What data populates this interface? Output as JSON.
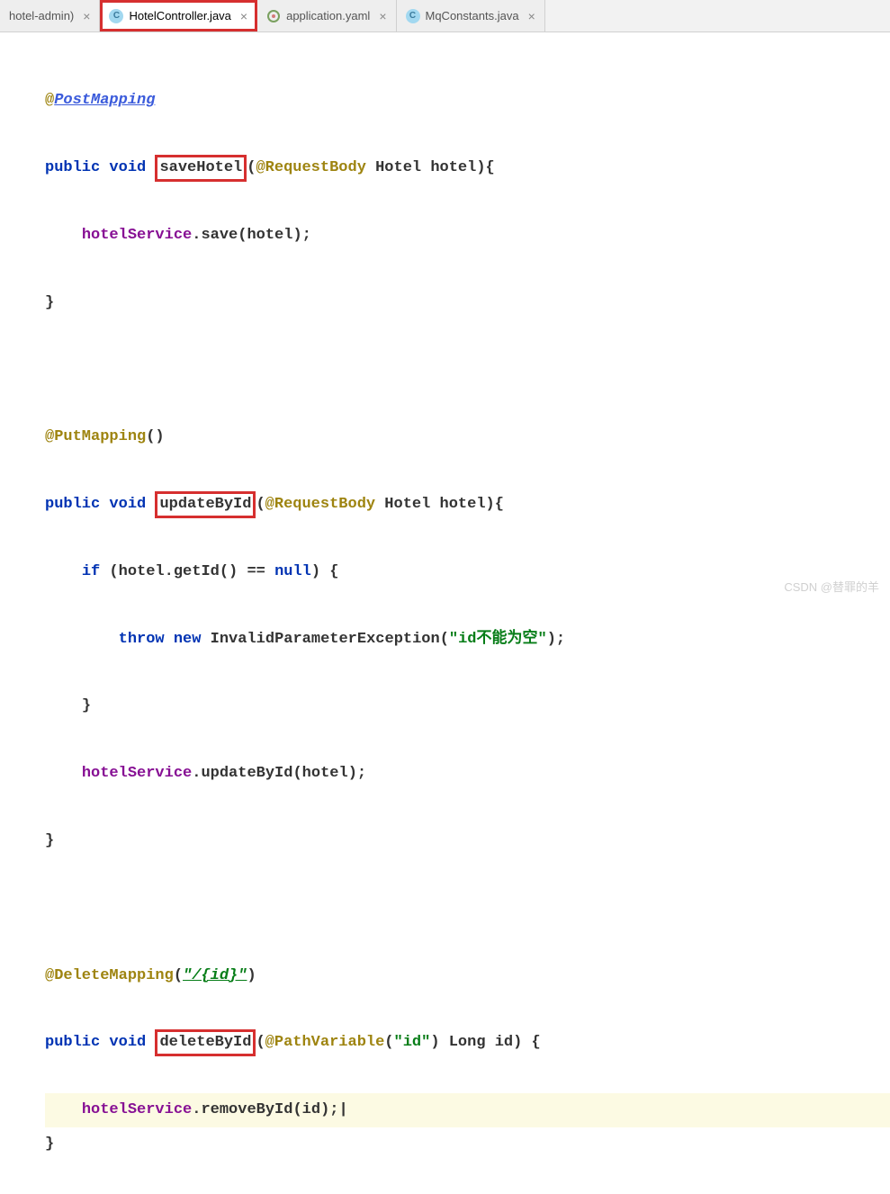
{
  "tabs": [
    {
      "label": "hotel-admin)",
      "icon": "",
      "close": "×"
    },
    {
      "label": "HotelController.java",
      "icon": "C",
      "close": "×"
    },
    {
      "label": "application.yaml",
      "icon": "Y",
      "close": "×"
    },
    {
      "label": "MqConstants.java",
      "icon": "C",
      "close": "×"
    }
  ],
  "code": {
    "postMapping": "PostMapping",
    "putMapping": "PutMapping",
    "deleteMapping": "DeleteMapping",
    "requestBody": "RequestBody",
    "pathVariable": "PathVariable",
    "public": "public",
    "void": "void",
    "if": "if",
    "throw": "throw",
    "new": "new",
    "null": "null",
    "saveHotel": "saveHotel",
    "updateById": "updateById",
    "deleteById": "deleteById",
    "Hotel": "Hotel",
    "hotel": "hotel",
    "Long": "Long",
    "id": "id",
    "hotelService": "hotelService",
    "save": "save",
    "updateByIdCall": "updateById",
    "removeById": "removeById",
    "getId": "getId",
    "InvalidParameterException": "InvalidParameterException",
    "idNotNull": "\"id不能为空\"",
    "idPath": "\"/{id}\"",
    "idStr": "\"id\""
  },
  "watermark": "CSDN @替罪的羊"
}
